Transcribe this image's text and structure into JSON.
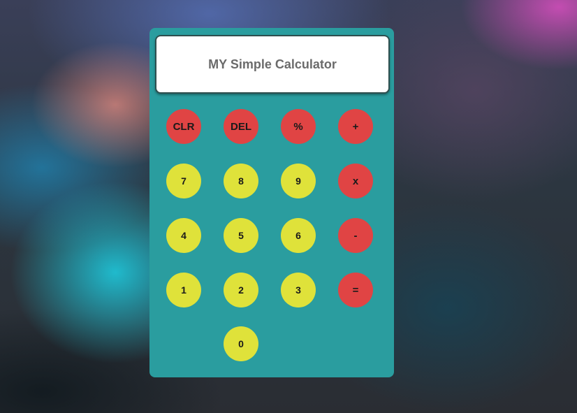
{
  "display": {
    "text": "MY Simple Calculator"
  },
  "keys": {
    "clr": "CLR",
    "del": "DEL",
    "percent": "%",
    "plus": "+",
    "seven": "7",
    "eight": "8",
    "nine": "9",
    "multiply": "x",
    "four": "4",
    "five": "5",
    "six": "6",
    "minus": "-",
    "one": "1",
    "two": "2",
    "three": "3",
    "equals": "=",
    "zero": "0"
  },
  "colors": {
    "body": "#2a9d9f",
    "operator_key": "#e04444",
    "number_key": "#dfe23a",
    "display_background": "#ffffff",
    "display_text": "#6b6b6b"
  }
}
